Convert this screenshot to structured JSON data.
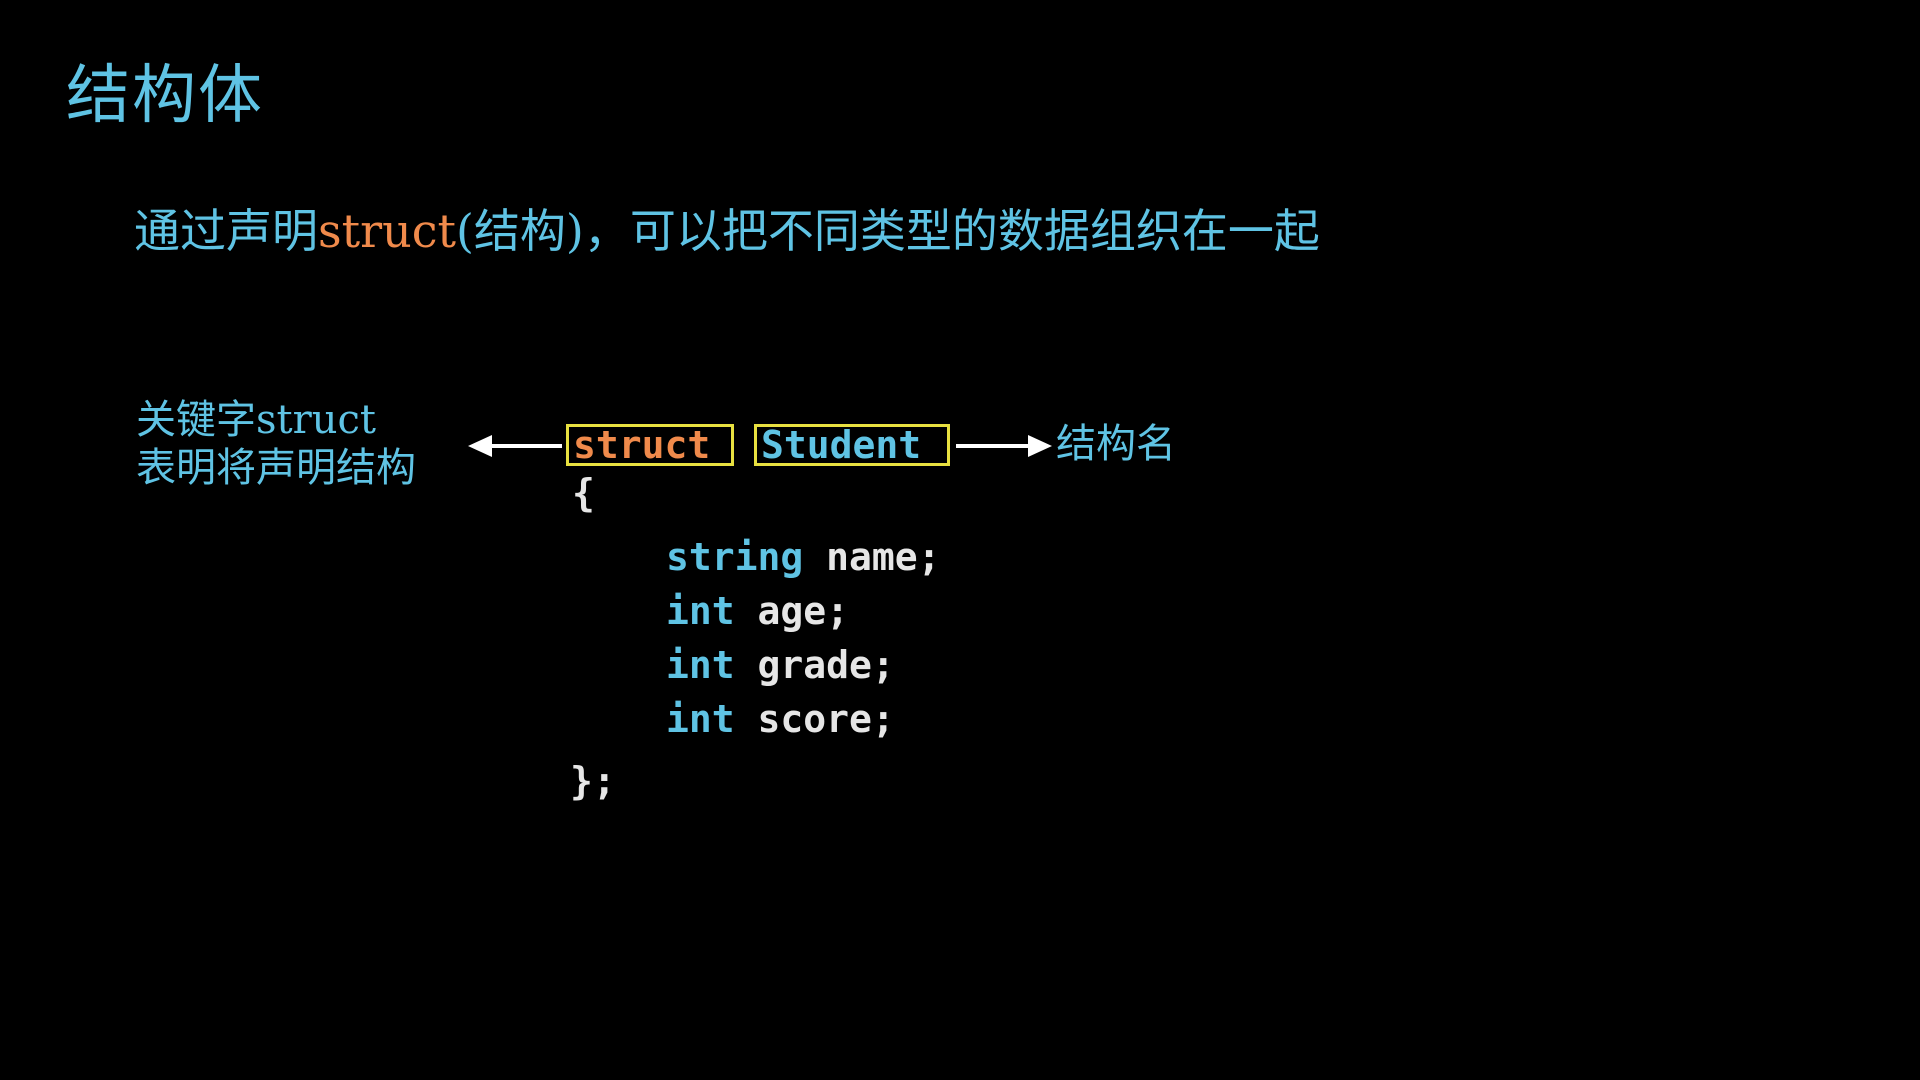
{
  "slide": {
    "title": "结构体",
    "subtitle": {
      "prefix": "通过声明",
      "keyword": "struct",
      "suffix": "(结构)，可以把不同类型的数据组织在一起"
    },
    "annotations": {
      "left_line1": "关键字struct",
      "left_line2": "表明将声明结构",
      "right": "结构名"
    },
    "code": {
      "keyword": "struct",
      "name": "Student",
      "open_brace": "{",
      "members": [
        {
          "type": "string",
          "name": " name;"
        },
        {
          "type": "int",
          "name": " age;"
        },
        {
          "type": "int",
          "name": " grade;"
        },
        {
          "type": "int",
          "name": " score;"
        }
      ],
      "close_brace": "};"
    },
    "colors": {
      "background": "#000000",
      "heading": "#5fc3e4",
      "keyword": "#f08a4b",
      "code_text": "#e6e6e6",
      "box_border": "#e8e040",
      "arrow": "#ffffff"
    }
  }
}
